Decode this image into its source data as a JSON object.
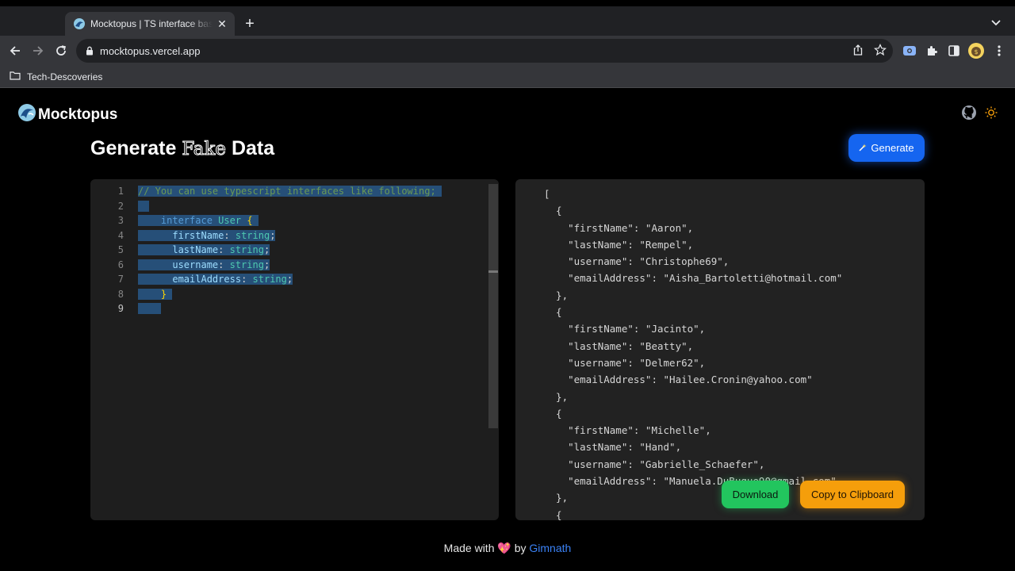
{
  "browser": {
    "tab_title": "Mocktopus | TS interface based fake data generator",
    "url": "mocktopus.vercel.app",
    "bookmark": "Tech-Descoveries"
  },
  "app": {
    "brand": "Mocktopus",
    "heading_pre": "Generate ",
    "heading_fake": "Fake",
    "heading_post": " Data",
    "generate_label": "Generate",
    "download_label": "Download",
    "copy_label": "Copy to Clipboard",
    "footer_pre": "Made with ",
    "footer_heart": "💖",
    "footer_by": " by ",
    "footer_author": "Gimnath"
  },
  "editor": {
    "line_numbers": [
      "1",
      "2",
      "3",
      "4",
      "5",
      "6",
      "7",
      "8",
      "9"
    ],
    "comment": "// You can use typescript interfaces like following;",
    "kw_interface": "interface",
    "type_name": "User",
    "open_brace": "{",
    "close_brace": "}",
    "props": [
      {
        "name": "firstName",
        "type": "string"
      },
      {
        "name": "lastName",
        "type": "string"
      },
      {
        "name": "username",
        "type": "string"
      },
      {
        "name": "emailAddress",
        "type": "string"
      }
    ]
  },
  "output_lines": [
    "[",
    "  {",
    "    \"firstName\": \"Aaron\",",
    "    \"lastName\": \"Rempel\",",
    "    \"username\": \"Christophe69\",",
    "    \"emailAddress\": \"Aisha_Bartoletti@hotmail.com\"",
    "  },",
    "  {",
    "    \"firstName\": \"Jacinto\",",
    "    \"lastName\": \"Beatty\",",
    "    \"username\": \"Delmer62\",",
    "    \"emailAddress\": \"Hailee.Cronin@yahoo.com\"",
    "  },",
    "  {",
    "    \"firstName\": \"Michelle\",",
    "    \"lastName\": \"Hand\",",
    "    \"username\": \"Gabrielle_Schaefer\",",
    "    \"emailAddress\": \"Manuela.DuBuque90@gmail.com\"",
    "  },",
    "  {"
  ],
  "colors": {
    "accent": "#1565f0",
    "download": "#22c55e",
    "copy": "#f59e0b",
    "link": "#3b82f6"
  }
}
